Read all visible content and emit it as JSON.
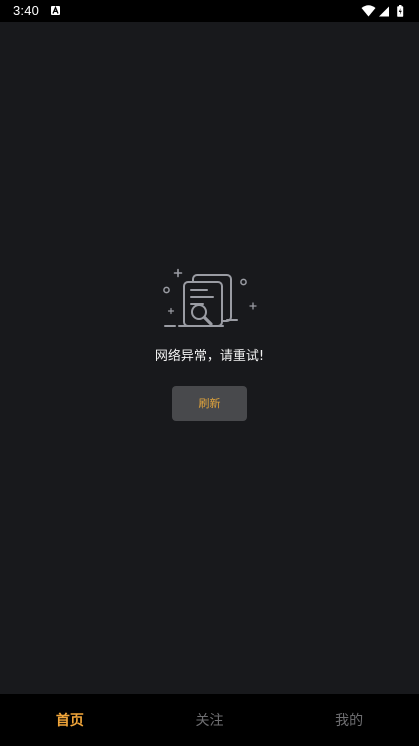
{
  "status_bar": {
    "time": "3:40",
    "notification_icon": "a-box-icon",
    "icons": [
      "wifi-icon",
      "cell-signal-icon",
      "battery-icon"
    ]
  },
  "empty_state": {
    "illustration": "document-search-icon",
    "message": "网络异常，请重试!",
    "refresh_label": "刷新"
  },
  "bottom_nav": {
    "tabs": [
      {
        "label": "首页",
        "active": true
      },
      {
        "label": "关注",
        "active": false
      },
      {
        "label": "我的",
        "active": false
      }
    ]
  },
  "colors": {
    "background": "#18191c",
    "accent": "#f0a53a",
    "inactive_tab": "#6f6f72",
    "button_bg": "#48494c"
  }
}
